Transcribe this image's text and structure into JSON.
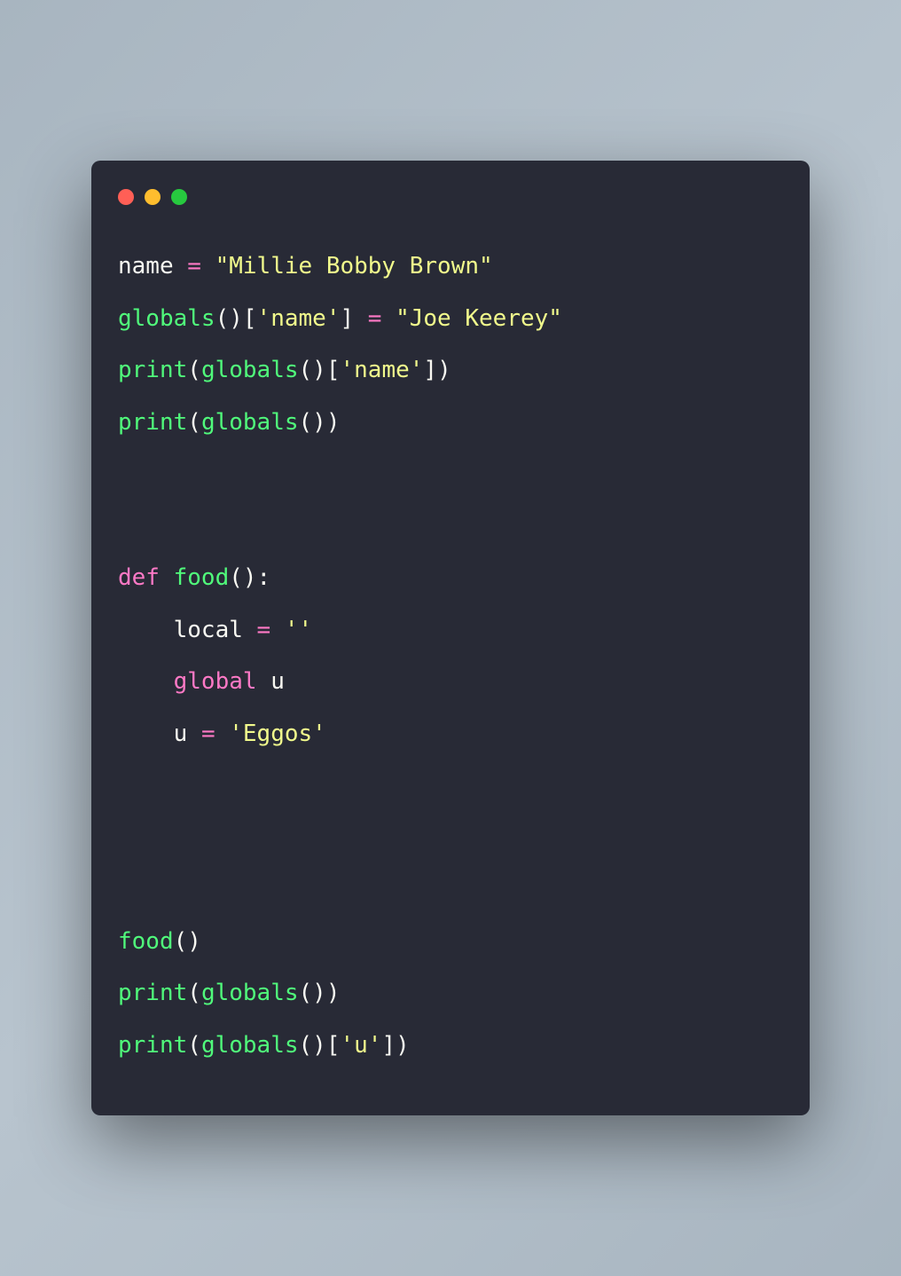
{
  "colors": {
    "bg": "#282a36",
    "red": "#ff5f56",
    "yellow": "#ffbd2e",
    "green": "#27c93f",
    "text": "#f8f8f2",
    "keyword": "#ff79c6",
    "string": "#f1fa8c",
    "function": "#50fa7b"
  },
  "code": {
    "line1": {
      "var": "name",
      "eq": " = ",
      "str": "\"Millie Bobby Brown\""
    },
    "line2": {
      "fn": "globals",
      "parens": "()",
      "lbr": "[",
      "key": "'name'",
      "rbr": "]",
      "eq": " = ",
      "val": "\"Joe Keerey\""
    },
    "line3": {
      "pr": "print",
      "lp": "(",
      "gl": "globals",
      "gp": "()",
      "lbr": "[",
      "key": "'name'",
      "rbr": "]",
      "rp": ")"
    },
    "line4": {
      "pr": "print",
      "lp": "(",
      "gl": "globals",
      "gp": "()",
      "rp": ")"
    },
    "line7": {
      "def": "def",
      "sp": " ",
      "name": "food",
      "parens": "():"
    },
    "line8": {
      "indent": "    ",
      "var": "local",
      "eq": " = ",
      "str": "''"
    },
    "line9": {
      "indent": "    ",
      "kw": "global",
      "sp": " ",
      "var": "u"
    },
    "line10": {
      "indent": "    ",
      "var": "u ",
      "eq": "= ",
      "str": "'Eggos'"
    },
    "line14": {
      "fn": "food",
      "parens": "()"
    },
    "line15": {
      "pr": "print",
      "lp": "(",
      "gl": "globals",
      "gp": "()",
      "rp": ")"
    },
    "line16": {
      "pr": "print",
      "lp": "(",
      "gl": "globals",
      "gp": "()",
      "lbr": "[",
      "key": "'u'",
      "rbr": "]",
      "rp": ")"
    }
  }
}
